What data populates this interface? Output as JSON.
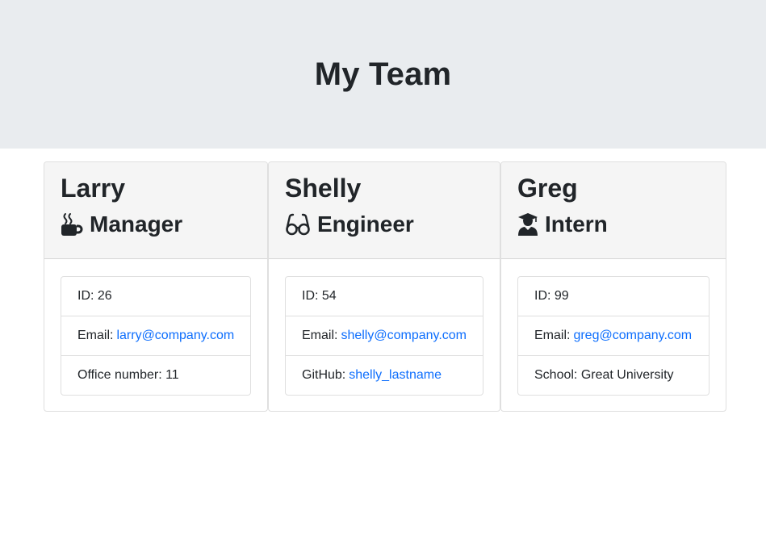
{
  "header": {
    "title": "My Team"
  },
  "employees": [
    {
      "name": "Larry",
      "role": "Manager",
      "icon": "coffee-mug-icon",
      "id_text": "ID: 26",
      "email_label": "Email:",
      "email": "larry@company.com",
      "extra_text": "Office number: 11"
    },
    {
      "name": "Shelly",
      "role": "Engineer",
      "icon": "glasses-icon",
      "id_text": "ID: 54",
      "email_label": "Email:",
      "email": "shelly@company.com",
      "extra_label": "GitHub:",
      "extra_link": "shelly_lastname"
    },
    {
      "name": "Greg",
      "role": "Intern",
      "icon": "graduate-icon",
      "id_text": "ID: 99",
      "email_label": "Email:",
      "email": "greg@company.com",
      "extra_text": "School: Great University"
    }
  ],
  "colors": {
    "jumbotron_bg": "#e9ecef",
    "card_header_bg": "#f5f5f5",
    "link": "#0d6efd"
  }
}
